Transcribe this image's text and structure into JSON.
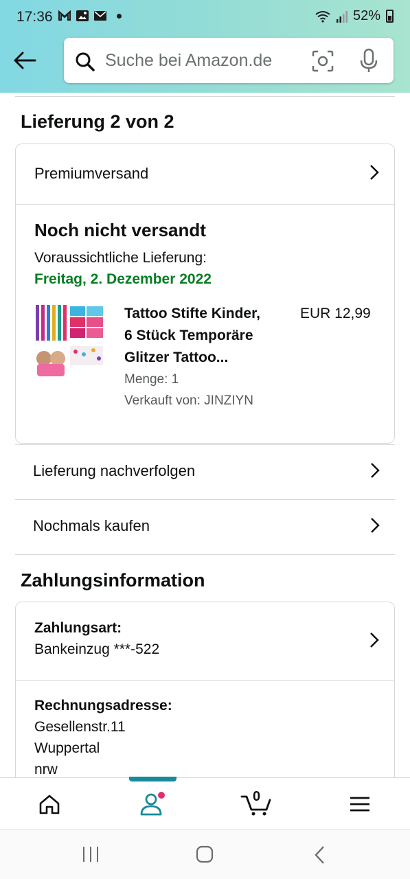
{
  "status_bar": {
    "time": "17:36",
    "battery": "52%"
  },
  "search": {
    "placeholder": "Suche bei Amazon.de"
  },
  "delivery": {
    "title": "Lieferung 2 von 2",
    "shipping_method": "Premiumversand",
    "status": "Noch nicht versandt",
    "expected_label": "Voraussichtliche Lieferung:",
    "expected_date": "Freitag, 2. Dezember 2022",
    "product": {
      "title_line1": "Tattoo Stifte Kinder,",
      "title_line2": "6 Stück Temporäre",
      "title_line3": "Glitzer Tattoo...",
      "price": "EUR 12,99",
      "quantity": "Menge: 1",
      "seller": "Verkauft von: JINZIYN"
    },
    "track_label": "Lieferung nachverfolgen",
    "buy_again_label": "Nochmals kaufen"
  },
  "payment": {
    "title": "Zahlungsinformation",
    "method_label": "Zahlungsart:",
    "method_value": "Bankeinzug ***-522",
    "billing_label": "Rechnungsadresse:",
    "billing_line1": "Gesellenstr.11",
    "billing_line2": "Wuppertal",
    "billing_line3": "nrw"
  },
  "bottom_nav": {
    "cart_count": "0"
  },
  "colors": {
    "accent": "#168b9b",
    "green": "#067d22",
    "badge": "#e0306a"
  }
}
